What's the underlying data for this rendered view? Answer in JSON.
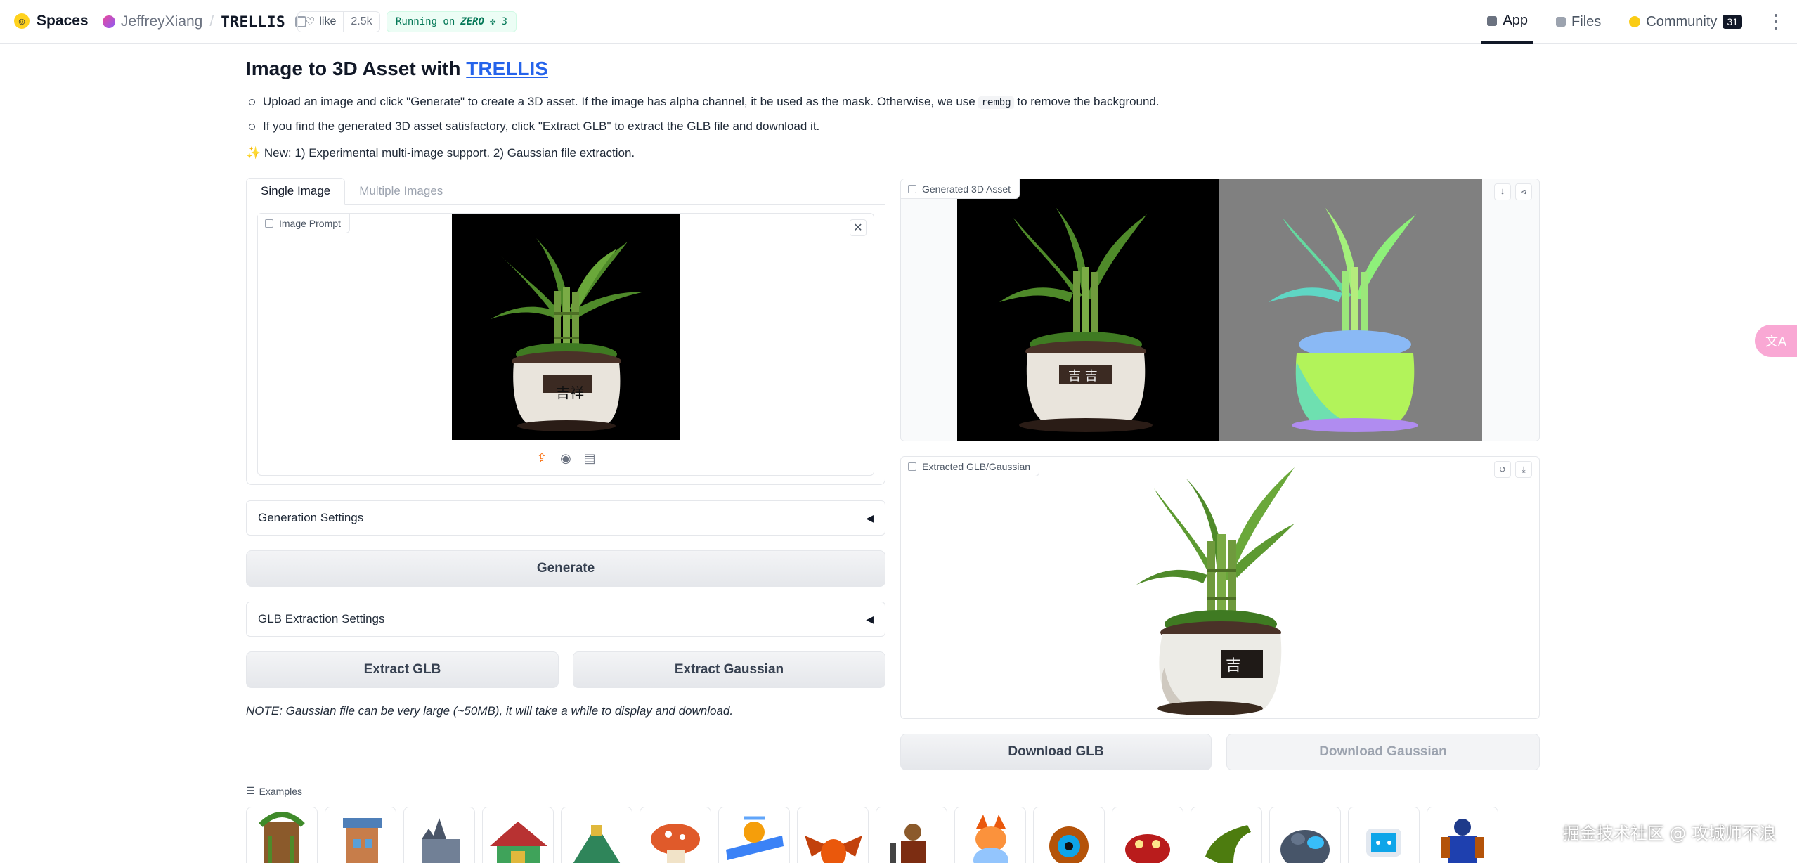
{
  "topbar": {
    "brand": "Spaces",
    "owner": "JeffreyXiang",
    "separator": "/",
    "repo": "TRELLIS",
    "like_label": "like",
    "like_count": "2.5k",
    "running_prefix": "Running on",
    "running_hw": "ZERO",
    "running_count": "3",
    "tabs": [
      {
        "label": "App",
        "active": true
      },
      {
        "label": "Files",
        "active": false
      },
      {
        "label": "Community",
        "active": false,
        "badge": "31"
      }
    ]
  },
  "header": {
    "title_prefix": "Image to 3D Asset with",
    "title_link": "TRELLIS",
    "bullets": [
      {
        "before": "Upload an image and click \"Generate\" to create a 3D asset. If the image has alpha channel, it be used as the mask. Otherwise, we use",
        "code": "rembg",
        "after": "to remove the background."
      },
      {
        "before": "If you find the generated 3D asset satisfactory, click \"Extract GLB\" to extract the GLB file and download it.",
        "code": "",
        "after": ""
      }
    ],
    "news_icon": "✨",
    "news": "New: 1) Experimental multi-image support. 2) Gaussian file extraction."
  },
  "left": {
    "tabs": [
      "Single Image",
      "Multiple Images"
    ],
    "image_prompt_label": "Image Prompt",
    "generation_settings": "Generation Settings",
    "generate_button": "Generate",
    "glb_settings": "GLB Extraction Settings",
    "extract_glb": "Extract GLB",
    "extract_gaussian": "Extract Gaussian",
    "note": "NOTE: Gaussian file can be very large (~50MB), it will take a while to display and download."
  },
  "right": {
    "video_label": "Generated 3D Asset",
    "model_label": "Extracted GLB/Gaussian",
    "download_glb": "Download GLB",
    "download_gaussian": "Download Gaussian"
  },
  "examples": {
    "label": "Examples",
    "items": [
      "vine-tower",
      "castle-tower",
      "stone-castle",
      "pagoda-house",
      "pyramid-temple",
      "mushroom-house",
      "windmill-drone",
      "red-dragon",
      "warrior",
      "fox-creature",
      "steampunk-eye",
      "robot-bug",
      "dinosaur",
      "rock-golem",
      "tv-robot",
      "armored-knight"
    ]
  },
  "watermark": "掘金技术社区 @ 攻城师不浪",
  "icons": {
    "accent_color": "#f97316",
    "link_color": "#2563eb"
  }
}
